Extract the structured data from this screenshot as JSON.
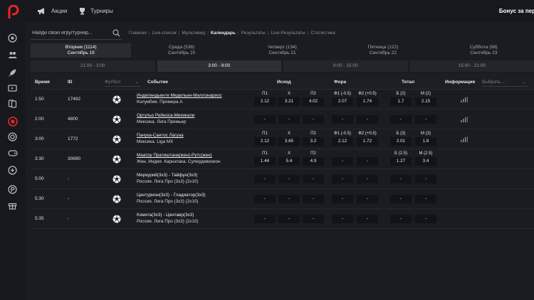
{
  "header": {
    "promos_label": "Акции",
    "tournaments_label": "Турниры",
    "bonus_label": "Бонус за пер"
  },
  "search": {
    "placeholder": "Найди свою игру/турнир..."
  },
  "breadcrumbs": [
    "Главная",
    "Live-список",
    "Мультивид",
    "Календарь",
    "Результаты",
    "Live-Результаты",
    "Статистика"
  ],
  "days": [
    {
      "day": "Вторник (1114)",
      "date": "Сентябрь 19"
    },
    {
      "day": "Среда (538)",
      "date": "Сентябрь 20"
    },
    {
      "day": "Четверг (134)",
      "date": "Сентябрь 21"
    },
    {
      "day": "Пятница (122)",
      "date": "Сентябрь 22"
    },
    {
      "day": "Суббота (68)",
      "date": "Сентябрь 23"
    }
  ],
  "time_slots": [
    "21:00 - 3:00",
    "3:00 - 9:00",
    "9:00 - 15:00",
    "15:00 - 21:00"
  ],
  "table": {
    "col_time": "Время",
    "col_id": "ID",
    "sport_select": "Футбол",
    "col_event": "Событие",
    "col_outcome": "Исход",
    "col_handicap": "Фора",
    "col_total": "Тотал",
    "col_info": "Информация",
    "info_select": "Выбрать ...",
    "rows": [
      {
        "time": "1:50",
        "id": "17492",
        "teams": "Индепендьенте Медельин-Миллонариос",
        "league": "Колумбия. Примера А",
        "labels": [
          "П1",
          "Х",
          "П2",
          "Ф1 (-0.5)",
          "Ф2 (+0.5)",
          "Б (2)",
          "М (2)"
        ],
        "odds": [
          "2.12",
          "3.21",
          "4.02",
          "2.07",
          "1.74",
          "1.7",
          "2.15"
        ]
      },
      {
        "time": "2:00",
        "id": "4800",
        "teams": "Оргульо Рейноса-Мехикали",
        "league": "Мексика. Лига Премьер",
        "labels": [
          "",
          "",
          "",
          "",
          "",
          "",
          ""
        ],
        "odds": [
          "-",
          "-",
          "-",
          "-",
          "-",
          "-",
          "-"
        ]
      },
      {
        "time": "3:00",
        "id": "1772",
        "teams": "Пачука-Сантос Лагуна",
        "league": "Мексика. Liga MX",
        "labels": [
          "П1",
          "Х",
          "П2",
          "Ф1 (-0.5)",
          "Ф2 (+0.5)",
          "Б (3)",
          "М (3)"
        ],
        "odds": [
          "2.12",
          "3.65",
          "3.2",
          "2.12",
          "1.72",
          "2.01",
          "1.8"
        ]
      },
      {
        "time": "3:30",
        "id": "30690",
        "teams": "Маатру Пратиштана(жен)-Рутс(жен)",
        "league": "Жен. Индия. Карнатака. Супердивизион",
        "labels": [
          "П1",
          "Х",
          "П2",
          "",
          "",
          "Б (2.5)",
          "М (2.5)"
        ],
        "odds": [
          "1.44",
          "5.4",
          "4.9",
          "-",
          "-",
          "1.27",
          "3.4"
        ]
      },
      {
        "time": "5:00",
        "id": "-",
        "teams": "Меркурий(3х3) - Тайфун(3х3)",
        "league": "Россия. Лига Про (3х3) (2х10)",
        "labels": [
          "",
          "",
          "",
          "",
          "",
          "",
          ""
        ],
        "odds": [
          "-",
          "-",
          "-",
          "-",
          "-",
          "-",
          "-"
        ]
      },
      {
        "time": "5:30",
        "id": "-",
        "teams": "Центурион(3х3) - Гладиатор(3х3)",
        "league": "Россия. Лига Про (3х3) (2х10)",
        "labels": [
          "",
          "",
          "",
          "",
          "",
          "",
          ""
        ],
        "odds": [
          "-",
          "-",
          "-",
          "-",
          "-",
          "-",
          "-"
        ]
      },
      {
        "time": "5:35",
        "id": "-",
        "teams": "Комета(3х3) - Центавр(3х3)",
        "league": "Россия. Лига Про (3х3) (2х10)",
        "labels": [
          "",
          "",
          "",
          "",
          "",
          "",
          ""
        ],
        "odds": [
          "-",
          "-",
          "-",
          "-",
          "-",
          "-",
          "-"
        ]
      }
    ]
  },
  "rail_icons": [
    "soccer-icon",
    "people-icon",
    "rocket-icon",
    "tv-icon",
    "cards-icon",
    "roulette-icon",
    "target-icon",
    "gamepad-icon",
    "joystick-icon",
    "poker-chip-icon",
    "gift-icon"
  ],
  "colors": {
    "accent": "#e8262b",
    "background": "#1b1c22",
    "panel": "#17181d",
    "odd_box": "#121318"
  }
}
